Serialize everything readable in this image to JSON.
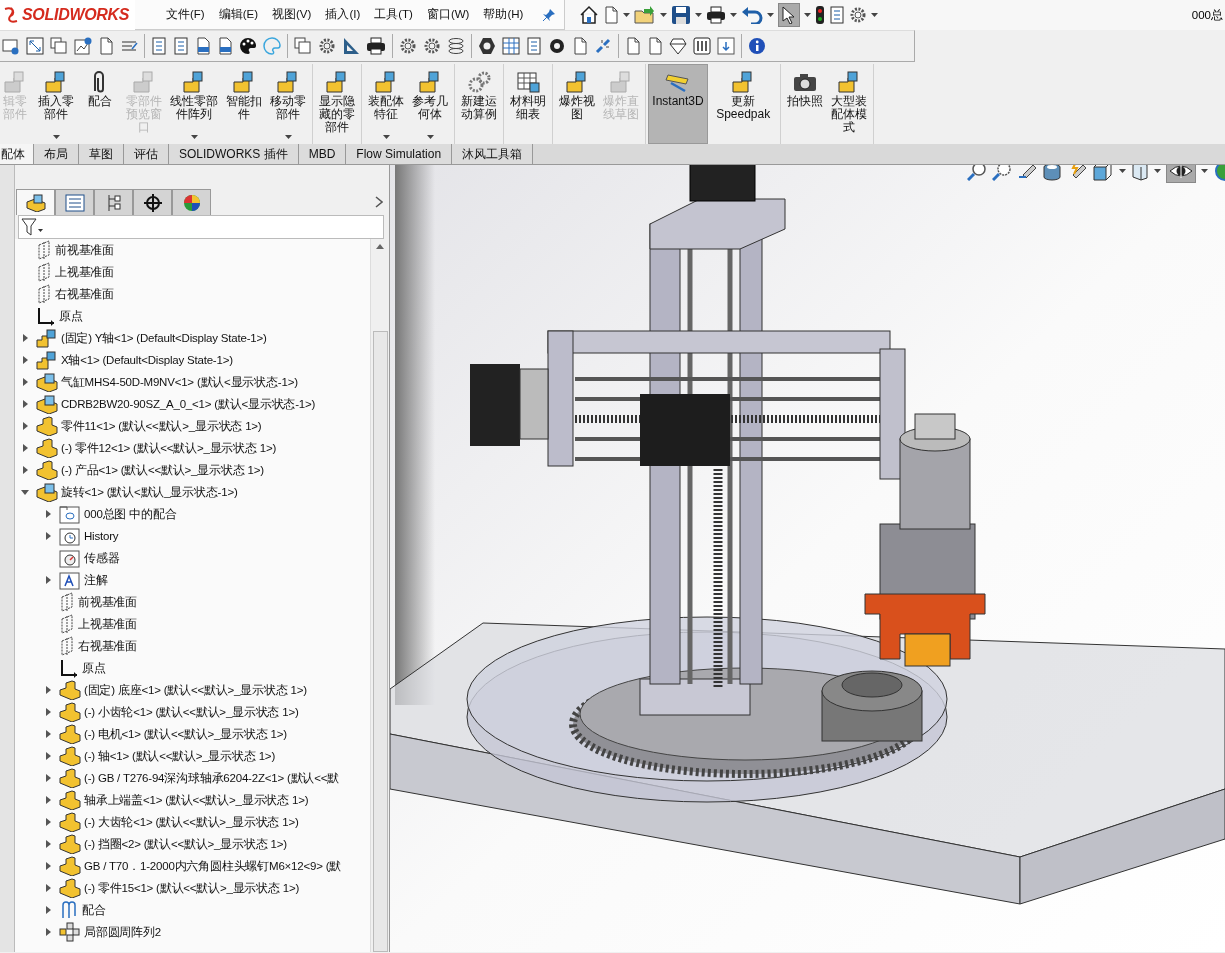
{
  "title_bar": {
    "brand": "SOLIDWORKS",
    "menu": [
      "文件(F)",
      "编辑(E)",
      "视图(V)",
      "插入(I)",
      "工具(T)",
      "窗口(W)",
      "帮助(H)"
    ],
    "select_tool_pressed": true,
    "document_title": "000总"
  },
  "ribbon": [
    {
      "buttons": [
        {
          "label": "辑零部件",
          "disabled": true,
          "pressed": false,
          "dropdown": false
        },
        {
          "label": "插入零部件",
          "disabled": false,
          "pressed": false,
          "dropdown": true
        },
        {
          "label": "配合",
          "disabled": false,
          "pressed": false,
          "dropdown": false
        },
        {
          "label": "零部件预览窗口",
          "disabled": true,
          "pressed": false,
          "dropdown": false
        },
        {
          "label": "线性零部件阵列",
          "disabled": false,
          "pressed": false,
          "dropdown": true
        },
        {
          "label": "智能扣件",
          "disabled": false,
          "pressed": false,
          "dropdown": false
        },
        {
          "label": "移动零部件",
          "disabled": false,
          "pressed": false,
          "dropdown": true
        }
      ]
    },
    {
      "buttons": [
        {
          "label": "显示隐藏的零部件",
          "disabled": false,
          "pressed": false,
          "dropdown": false
        }
      ]
    },
    {
      "buttons": [
        {
          "label": "装配体特征",
          "disabled": false,
          "pressed": false,
          "dropdown": true
        },
        {
          "label": "参考几何体",
          "disabled": false,
          "pressed": false,
          "dropdown": true
        }
      ]
    },
    {
      "buttons": [
        {
          "label": "新建运动算例",
          "disabled": false,
          "pressed": false,
          "dropdown": false
        }
      ]
    },
    {
      "buttons": [
        {
          "label": "材料明细表",
          "disabled": false,
          "pressed": false,
          "dropdown": false
        }
      ]
    },
    {
      "buttons": [
        {
          "label": "爆炸视图",
          "disabled": false,
          "pressed": false,
          "dropdown": false
        },
        {
          "label": "爆炸直线草图",
          "disabled": true,
          "pressed": false,
          "dropdown": false
        }
      ]
    },
    {
      "buttons": [
        {
          "label": "Instant3D",
          "disabled": false,
          "pressed": true,
          "dropdown": false
        },
        {
          "label": "更新Speedpak",
          "disabled": false,
          "pressed": false,
          "dropdown": false
        }
      ]
    },
    {
      "buttons": [
        {
          "label": "拍快照",
          "disabled": false,
          "pressed": false,
          "dropdown": false
        },
        {
          "label": "大型装配体模式",
          "disabled": false,
          "pressed": false,
          "dropdown": false
        }
      ]
    }
  ],
  "tabs": [
    {
      "label": "配体",
      "selected": true
    },
    {
      "label": "布局",
      "selected": false
    },
    {
      "label": "草图",
      "selected": false
    },
    {
      "label": "评估",
      "selected": false
    },
    {
      "label": "SOLIDWORKS 插件",
      "selected": false
    },
    {
      "label": "MBD",
      "selected": false
    },
    {
      "label": "Flow Simulation",
      "selected": false
    },
    {
      "label": "沐风工具箱",
      "selected": false
    }
  ],
  "panel_tabs": [
    {
      "selected": true
    },
    {
      "selected": false
    },
    {
      "selected": false
    },
    {
      "selected": false
    },
    {
      "selected": false
    }
  ],
  "feature_tree": {
    "items": [
      {
        "kind": "plane",
        "label": "前视基准面"
      },
      {
        "kind": "plane",
        "label": "上视基准面"
      },
      {
        "kind": "plane",
        "label": "右视基准面"
      },
      {
        "kind": "origin",
        "label": "原点"
      },
      {
        "kind": "subassembly",
        "label": "(固定) Y轴<1> (Default<Display State-1>)",
        "expanded": false
      },
      {
        "kind": "subassembly",
        "label": "X轴<1> (Default<Display State-1>)",
        "expanded": false
      },
      {
        "kind": "assembly",
        "label": "气缸MHS4-50D-M9NV<1> (默认<显示状态-1>)",
        "expanded": false
      },
      {
        "kind": "assembly",
        "label": "CDRB2BW20-90SZ_A_0_<1> (默认<显示状态-1>)",
        "expanded": false
      },
      {
        "kind": "part",
        "label": "零件11<1> (默认<<默认>_显示状态 1>)",
        "expanded": false
      },
      {
        "kind": "part",
        "label": "(-) 零件12<1> (默认<<默认>_显示状态 1>)",
        "expanded": false
      },
      {
        "kind": "part",
        "label": "(-) 产品<1> (默认<<默认>_显示状态 1>)",
        "expanded": false
      },
      {
        "kind": "assembly",
        "label": "旋转<1> (默认<默认_显示状态-1>)",
        "expanded": true,
        "children": [
          {
            "kind": "matesfolder",
            "label": "000总图 中的配合",
            "expanded": false
          },
          {
            "kind": "history",
            "label": "History",
            "expanded": false
          },
          {
            "kind": "sensor",
            "label": "传感器"
          },
          {
            "kind": "notes",
            "label": "注解",
            "expanded": false
          },
          {
            "kind": "plane",
            "label": "前视基准面"
          },
          {
            "kind": "plane",
            "label": "上视基准面"
          },
          {
            "kind": "plane",
            "label": "右视基准面"
          },
          {
            "kind": "origin",
            "label": "原点"
          },
          {
            "kind": "part",
            "label": "(固定) 底座<1> (默认<<默认>_显示状态 1>)",
            "expanded": false
          },
          {
            "kind": "part",
            "label": "(-) 小齿轮<1> (默认<<默认>_显示状态 1>)",
            "expanded": false
          },
          {
            "kind": "part",
            "label": "(-) 电机<1> (默认<<默认>_显示状态 1>)",
            "expanded": false
          },
          {
            "kind": "part",
            "label": "(-) 轴<1> (默认<<默认>_显示状态 1>)",
            "expanded": false
          },
          {
            "kind": "part",
            "label": "(-) GB / T276-94深沟球轴承6204-2Z<1> (默认<<默",
            "expanded": false
          },
          {
            "kind": "part",
            "label": "轴承上端盖<1> (默认<<默认>_显示状态 1>)",
            "expanded": false
          },
          {
            "kind": "part",
            "label": "(-) 大齿轮<1> (默认<<默认>_显示状态 1>)",
            "expanded": false
          },
          {
            "kind": "part",
            "label": "(-) 挡圈<2> (默认<<默认>_显示状态 1>)",
            "expanded": false
          },
          {
            "kind": "part",
            "label": "GB / T70．1-2000内六角圆柱头螺钉M6×12<9> (默",
            "expanded": false
          },
          {
            "kind": "part",
            "label": "(-) 零件15<1> (默认<<默认>_显示状态 1>)",
            "expanded": false
          },
          {
            "kind": "mates",
            "label": "配合",
            "expanded": false
          },
          {
            "kind": "pattern",
            "label": "局部圆周阵列2",
            "expanded": false
          }
        ]
      }
    ]
  },
  "view_toolbar": {
    "display_toggle_pressed": true
  }
}
